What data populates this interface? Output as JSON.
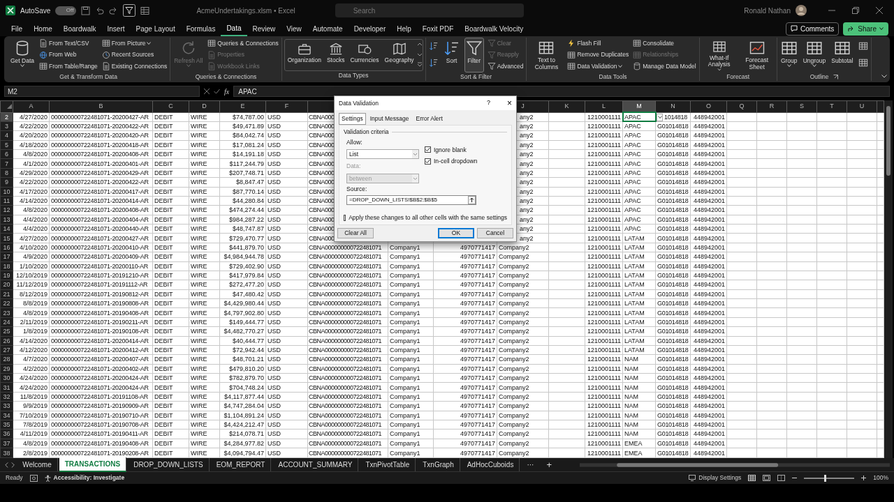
{
  "title_bar": {
    "autosave_label": "AutoSave",
    "autosave": {
      "on": false,
      "label": "Off"
    },
    "file_title": "AcmeUndertakings.xlsm • Excel",
    "search_placeholder": "Search",
    "user": "Ronald Nathan"
  },
  "menu_tabs": [
    {
      "label": "File",
      "selected": false
    },
    {
      "label": "Home",
      "selected": false
    },
    {
      "label": "Boardwalk",
      "selected": false
    },
    {
      "label": "Insert",
      "selected": false
    },
    {
      "label": "Page Layout",
      "selected": false
    },
    {
      "label": "Formulas",
      "selected": false
    },
    {
      "label": "Data",
      "selected": true
    },
    {
      "label": "Review",
      "selected": false
    },
    {
      "label": "View",
      "selected": false
    },
    {
      "label": "Automate",
      "selected": false
    },
    {
      "label": "Developer",
      "selected": false
    },
    {
      "label": "Help",
      "selected": false
    },
    {
      "label": "Foxit PDF",
      "selected": false
    },
    {
      "label": "Boardwalk Velocity",
      "selected": false
    }
  ],
  "comments_button": "Comments",
  "share_button": "Share",
  "ribbon": {
    "groups": [
      {
        "label": "Get & Transform Data",
        "kind": "buttons",
        "launcher": false,
        "items": [
          {
            "kind": "large",
            "label": "Get Data",
            "disabled": false,
            "dropdown": true,
            "pressed": false
          },
          {
            "kind": "small",
            "label": "From Text/CSV",
            "disabled": false,
            "dropdown": false,
            "pressed": false
          },
          {
            "kind": "small",
            "label": "From Web",
            "disabled": false,
            "dropdown": false,
            "pressed": false
          },
          {
            "kind": "small",
            "label": "From Table/Range",
            "disabled": false,
            "dropdown": false,
            "pressed": false
          },
          {
            "kind": "small",
            "label": "From Picture",
            "disabled": false,
            "dropdown": true,
            "pressed": false
          },
          {
            "kind": "small",
            "label": "Recent Sources",
            "disabled": false,
            "dropdown": false,
            "pressed": false
          },
          {
            "kind": "small",
            "label": "Existing Connections",
            "disabled": false,
            "dropdown": false,
            "pressed": false
          }
        ]
      },
      {
        "label": "Queries & Connections",
        "kind": "buttons",
        "launcher": false,
        "items": [
          {
            "kind": "large",
            "label": "Refresh All",
            "disabled": true,
            "dropdown": true,
            "pressed": false
          },
          {
            "kind": "small",
            "label": "Queries & Connections",
            "disabled": false,
            "dropdown": false,
            "pressed": false
          },
          {
            "kind": "small",
            "label": "Properties",
            "disabled": true,
            "dropdown": false,
            "pressed": false
          },
          {
            "kind": "small",
            "label": "Workbook Links",
            "disabled": true,
            "dropdown": false,
            "pressed": false
          }
        ]
      },
      {
        "label": "Data Types",
        "kind": "gallery",
        "launcher": false,
        "items": [
          {
            "kind": "large",
            "label": "Organization",
            "disabled": false,
            "dropdown": false,
            "pressed": false
          },
          {
            "kind": "large",
            "label": "Stocks",
            "disabled": false,
            "dropdown": false,
            "pressed": false
          },
          {
            "kind": "large",
            "label": "Currencies",
            "disabled": false,
            "dropdown": false,
            "pressed": false
          },
          {
            "kind": "large",
            "label": "Geography",
            "disabled": false,
            "dropdown": false,
            "pressed": false
          }
        ]
      },
      {
        "label": "Sort & Filter",
        "kind": "buttons",
        "launcher": false,
        "items": [
          {
            "kind": "icon",
            "disabled": false,
            "dropdown": false,
            "pressed": false
          },
          {
            "kind": "icon",
            "disabled": false,
            "dropdown": false,
            "pressed": false
          },
          {
            "kind": "large",
            "label": "Sort",
            "disabled": false,
            "dropdown": false,
            "pressed": false
          },
          {
            "kind": "large",
            "label": "Filter",
            "disabled": false,
            "dropdown": false,
            "pressed": true
          },
          {
            "kind": "small",
            "label": "Clear",
            "disabled": true,
            "dropdown": false,
            "pressed": false
          },
          {
            "kind": "small",
            "label": "Reapply",
            "disabled": true,
            "dropdown": false,
            "pressed": false
          },
          {
            "kind": "small",
            "label": "Advanced",
            "disabled": false,
            "dropdown": false,
            "pressed": false
          }
        ]
      },
      {
        "label": "Data Tools",
        "kind": "buttons",
        "launcher": false,
        "items": [
          {
            "kind": "large",
            "label": "Text to Columns",
            "disabled": false,
            "dropdown": false,
            "pressed": false
          },
          {
            "kind": "small",
            "label": "Flash Fill",
            "disabled": false,
            "dropdown": false,
            "pressed": false
          },
          {
            "kind": "small",
            "label": "Remove Duplicates",
            "disabled": false,
            "dropdown": false,
            "pressed": false
          },
          {
            "kind": "small",
            "label": "Data Validation",
            "disabled": false,
            "dropdown": true,
            "pressed": false
          },
          {
            "kind": "small",
            "label": "Consolidate",
            "disabled": false,
            "dropdown": false,
            "pressed": false
          },
          {
            "kind": "small",
            "label": "Relationships",
            "disabled": true,
            "dropdown": false,
            "pressed": false
          },
          {
            "kind": "small",
            "label": "Manage Data Model",
            "disabled": false,
            "dropdown": false,
            "pressed": false
          }
        ]
      },
      {
        "label": "Forecast",
        "kind": "buttons",
        "launcher": false,
        "items": [
          {
            "kind": "large",
            "label": "What-If Analysis",
            "disabled": false,
            "dropdown": true,
            "pressed": false
          },
          {
            "kind": "large",
            "label": "Forecast Sheet",
            "disabled": false,
            "dropdown": false,
            "pressed": false
          }
        ]
      },
      {
        "label": "Outline",
        "kind": "buttons",
        "launcher": true,
        "items": [
          {
            "kind": "large",
            "label": "Group",
            "disabled": false,
            "dropdown": true,
            "pressed": false
          },
          {
            "kind": "large",
            "label": "Ungroup",
            "disabled": false,
            "dropdown": true,
            "pressed": false
          },
          {
            "kind": "large",
            "label": "Subtotal",
            "disabled": false,
            "dropdown": false,
            "pressed": false
          },
          {
            "kind": "icon",
            "disabled": false,
            "dropdown": false,
            "pressed": false
          },
          {
            "kind": "icon",
            "disabled": false,
            "dropdown": false,
            "pressed": false
          }
        ]
      }
    ]
  },
  "formula_bar": {
    "name_box": "M2",
    "fx": "fx",
    "formula": "APAC"
  },
  "grid": {
    "active_dropdown": true,
    "columns": [
      {
        "label": "A",
        "selected": false
      },
      {
        "label": "B",
        "selected": false
      },
      {
        "label": "C",
        "selected": false
      },
      {
        "label": "D",
        "selected": false
      },
      {
        "label": "E",
        "selected": false
      },
      {
        "label": "F",
        "selected": false
      },
      null,
      null,
      null,
      {
        "label": "J",
        "selected": false
      },
      {
        "label": "K",
        "selected": false
      },
      {
        "label": "L",
        "selected": false
      },
      {
        "label": "M",
        "selected": true
      },
      {
        "label": "N",
        "selected": false
      },
      {
        "label": "O",
        "selected": false
      },
      {
        "label": "Q",
        "selected": false
      },
      {
        "label": "R",
        "selected": false
      },
      {
        "label": "S",
        "selected": false
      },
      {
        "label": "T",
        "selected": false
      },
      {
        "label": "U",
        "selected": false
      }
    ],
    "rows": [
      {
        "row": "2",
        "selected": true,
        "covered": true,
        "cells": [
          "4/27/2020",
          "000000000722481071-20200427-AR",
          "DEBIT",
          "WIRE",
          "$74,787.00",
          "USD",
          "CBNA000",
          null,
          null,
          "any2",
          null,
          "1210001111",
          "APAC",
          "1014818",
          "448942001"
        ]
      },
      {
        "row": "3",
        "selected": false,
        "covered": true,
        "cells": [
          "4/22/2020",
          "000000000722481071-20200422-AR",
          "DEBIT",
          "WIRE",
          "$49,471.89",
          "USD",
          "CBNA000",
          null,
          null,
          "any2",
          null,
          "1210001111",
          "APAC",
          "G01014818",
          "448942001"
        ]
      },
      {
        "row": "4",
        "selected": false,
        "covered": true,
        "cells": [
          "4/20/2020",
          "000000000722481071-20200420-AR",
          "DEBIT",
          "WIRE",
          "$84,042.74",
          "USD",
          "CBNA000",
          null,
          null,
          "any2",
          null,
          "1210001111",
          "APAC",
          "G01014818",
          "448942001"
        ]
      },
      {
        "row": "5",
        "selected": false,
        "covered": true,
        "cells": [
          "4/18/2020",
          "000000000722481071-20200418-AR",
          "DEBIT",
          "WIRE",
          "$17,081.24",
          "USD",
          "CBNA000",
          null,
          null,
          "any2",
          null,
          "1210001111",
          "APAC",
          "G01014818",
          "448942001"
        ]
      },
      {
        "row": "6",
        "selected": false,
        "covered": true,
        "cells": [
          "4/8/2020",
          "000000000722481071-20200408-AR",
          "DEBIT",
          "WIRE",
          "$14,191.18",
          "USD",
          "CBNA000",
          null,
          null,
          "any2",
          null,
          "1210001111",
          "APAC",
          "G01014818",
          "448942001"
        ]
      },
      {
        "row": "7",
        "selected": false,
        "covered": true,
        "cells": [
          "4/1/2020",
          "000000000722481071-20200401-AR",
          "DEBIT",
          "WIRE",
          "$117,244.79",
          "USD",
          "CBNA000",
          null,
          null,
          "any2",
          null,
          "1210001111",
          "APAC",
          "G01014818",
          "448942001"
        ]
      },
      {
        "row": "8",
        "selected": false,
        "covered": true,
        "cells": [
          "4/29/2020",
          "000000000722481071-20200429-AR",
          "DEBIT",
          "WIRE",
          "$207,748.71",
          "USD",
          "CBNA000",
          null,
          null,
          "any2",
          null,
          "1210001111",
          "APAC",
          "G01014818",
          "448942001"
        ]
      },
      {
        "row": "9",
        "selected": false,
        "covered": true,
        "cells": [
          "4/22/2020",
          "000000000722481071-20200422-AR",
          "DEBIT",
          "WIRE",
          "$8,847.47",
          "USD",
          "CBNA000",
          null,
          null,
          "any2",
          null,
          "1210001111",
          "APAC",
          "G01014818",
          "448942001"
        ]
      },
      {
        "row": "10",
        "selected": false,
        "covered": true,
        "cells": [
          "4/17/2020",
          "000000000722481071-20200417-AR",
          "DEBIT",
          "WIRE",
          "$87,770.14",
          "USD",
          "CBNA000",
          null,
          null,
          "any2",
          null,
          "1210001111",
          "APAC",
          "G01014818",
          "448942001"
        ]
      },
      {
        "row": "11",
        "selected": false,
        "covered": true,
        "cells": [
          "4/14/2020",
          "000000000722481071-20200414-AR",
          "DEBIT",
          "WIRE",
          "$44,280.84",
          "USD",
          "CBNA000",
          null,
          null,
          "any2",
          null,
          "1210001111",
          "APAC",
          "G01014818",
          "448942001"
        ]
      },
      {
        "row": "12",
        "selected": false,
        "covered": true,
        "cells": [
          "4/8/2020",
          "000000000722481071-20200408-AR",
          "DEBIT",
          "WIRE",
          "$474,274.44",
          "USD",
          "CBNA000",
          null,
          null,
          "any2",
          null,
          "1210001111",
          "APAC",
          "G01014818",
          "448942001"
        ]
      },
      {
        "row": "13",
        "selected": false,
        "covered": true,
        "cells": [
          "4/4/2020",
          "000000000722481071-20200404-AR",
          "DEBIT",
          "WIRE",
          "$984,287.22",
          "USD",
          "CBNA000",
          null,
          null,
          "any2",
          null,
          "1210001111",
          "APAC",
          "G01014818",
          "448942001"
        ]
      },
      {
        "row": "14",
        "selected": false,
        "covered": true,
        "cells": [
          "4/4/2020",
          "000000000722481071-20200440-AR",
          "DEBIT",
          "WIRE",
          "$48,747.87",
          "USD",
          "CBNA000",
          null,
          null,
          "any2",
          null,
          "1210001111",
          "APAC",
          "G01014818",
          "448942001"
        ]
      },
      {
        "row": "15",
        "selected": false,
        "covered": true,
        "cells": [
          "4/27/2020",
          "000000000722481071-20200427-AR",
          "DEBIT",
          "WIRE",
          "$729,470.77",
          "USD",
          "CBNA000",
          null,
          null,
          "any2",
          null,
          "1210001111",
          "LATAM",
          "G01014818",
          "448942001"
        ]
      },
      {
        "row": "16",
        "selected": false,
        "covered": false,
        "cells": [
          "4/10/2020",
          "000000000722481071-20200410-AR",
          "DEBIT",
          "WIRE",
          "$441,879.70",
          "USD",
          "CBNA000000000722481071",
          "Company1",
          "4970771417",
          "Company2",
          null,
          "1210001111",
          "LATAM",
          "G01014818",
          "448942001"
        ]
      },
      {
        "row": "17",
        "selected": false,
        "covered": false,
        "cells": [
          "4/9/2020",
          "000000000722481071-20200409-AR",
          "DEBIT",
          "WIRE",
          "$4,984,944.78",
          "USD",
          "CBNA000000000722481071",
          "Company1",
          "4970771417",
          "Company2",
          null,
          "1210001111",
          "LATAM",
          "G01014818",
          "448942001"
        ]
      },
      {
        "row": "18",
        "selected": false,
        "covered": false,
        "cells": [
          "1/10/2020",
          "000000000722481071-20200110-AR",
          "DEBIT",
          "WIRE",
          "$729,402.90",
          "USD",
          "CBNA000000000722481071",
          "Company1",
          "4970771417",
          "Company2",
          null,
          "1210001111",
          "LATAM",
          "G01014818",
          "448942001"
        ]
      },
      {
        "row": "19",
        "selected": false,
        "covered": false,
        "cells": [
          "12/10/2019",
          "000000000722481071-20191210-AR",
          "DEBIT",
          "WIRE",
          "$417,979.84",
          "USD",
          "CBNA000000000722481071",
          "Company1",
          "4970771417",
          "Company2",
          null,
          "1210001111",
          "LATAM",
          "G01014818",
          "448942001"
        ]
      },
      {
        "row": "20",
        "selected": false,
        "covered": false,
        "cells": [
          "11/12/2019",
          "000000000722481071-20191112-AR",
          "DEBIT",
          "WIRE",
          "$272,477.20",
          "USD",
          "CBNA000000000722481071",
          "Company1",
          "4970771417",
          "Company2",
          null,
          "1210001111",
          "LATAM",
          "G01014818",
          "448942001"
        ]
      },
      {
        "row": "21",
        "selected": false,
        "covered": false,
        "cells": [
          "8/12/2019",
          "000000000722481071-20190812-AR",
          "DEBIT",
          "WIRE",
          "$47,480.42",
          "USD",
          "CBNA000000000722481071",
          "Company1",
          "4970771417",
          "Company2",
          null,
          "1210001111",
          "LATAM",
          "G01014818",
          "448942001"
        ]
      },
      {
        "row": "22",
        "selected": false,
        "covered": false,
        "cells": [
          "8/8/2019",
          "000000000722481071-20190808-AR",
          "DEBIT",
          "WIRE",
          "$4,429,980.44",
          "USD",
          "CBNA000000000722481071",
          "Company1",
          "4970771417",
          "Company2",
          null,
          "1210001111",
          "LATAM",
          "G01014818",
          "448942001"
        ]
      },
      {
        "row": "23",
        "selected": false,
        "covered": false,
        "cells": [
          "4/8/2019",
          "000000000722481071-20190408-AR",
          "DEBIT",
          "WIRE",
          "$4,797,902.80",
          "USD",
          "CBNA000000000722481071",
          "Company1",
          "4970771417",
          "Company2",
          null,
          "1210001111",
          "LATAM",
          "G01014818",
          "448942001"
        ]
      },
      {
        "row": "24",
        "selected": false,
        "covered": false,
        "cells": [
          "2/11/2019",
          "000000000722481071-20190211-AR",
          "DEBIT",
          "WIRE",
          "$149,444.77",
          "USD",
          "CBNA000000000722481071",
          "Company1",
          "4970771417",
          "Company2",
          null,
          "1210001111",
          "LATAM",
          "G01014818",
          "448942001"
        ]
      },
      {
        "row": "25",
        "selected": false,
        "covered": false,
        "cells": [
          "1/8/2019",
          "000000000722481071-20190108-AR",
          "DEBIT",
          "WIRE",
          "$4,482,770.27",
          "USD",
          "CBNA000000000722481071",
          "Company1",
          "4970771417",
          "Company2",
          null,
          "1210001111",
          "LATAM",
          "G01014818",
          "448942001"
        ]
      },
      {
        "row": "26",
        "selected": false,
        "covered": false,
        "cells": [
          "4/14/2020",
          "000000000722481071-20200414-AR",
          "DEBIT",
          "WIRE",
          "$40,444.77",
          "USD",
          "CBNA000000000722481071",
          "Company1",
          "4970771417",
          "Company2",
          null,
          "1210001111",
          "LATAM",
          "G01014818",
          "448942001"
        ]
      },
      {
        "row": "27",
        "selected": false,
        "covered": false,
        "cells": [
          "4/12/2020",
          "000000000722481071-20200412-AR",
          "DEBIT",
          "WIRE",
          "$72,942.44",
          "USD",
          "CBNA000000000722481071",
          "Company1",
          "4970771417",
          "Company2",
          null,
          "1210001111",
          "LATAM",
          "G01014818",
          "448942001"
        ]
      },
      {
        "row": "28",
        "selected": false,
        "covered": false,
        "cells": [
          "4/7/2020",
          "000000000722481071-20200407-AR",
          "DEBIT",
          "WIRE",
          "$48,701.21",
          "USD",
          "CBNA000000000722481071",
          "Company1",
          "4970771417",
          "Company2",
          null,
          "1210001111",
          "NAM",
          "G01014818",
          "448942001"
        ]
      },
      {
        "row": "29",
        "selected": false,
        "covered": false,
        "cells": [
          "4/2/2020",
          "000000000722481071-20200402-AR",
          "DEBIT",
          "WIRE",
          "$479,810.20",
          "USD",
          "CBNA000000000722481071",
          "Company1",
          "4970771417",
          "Company2",
          null,
          "1210001111",
          "NAM",
          "G01014818",
          "448942001"
        ]
      },
      {
        "row": "30",
        "selected": false,
        "covered": false,
        "cells": [
          "4/24/2020",
          "000000000722481071-20200424-AR",
          "DEBIT",
          "WIRE",
          "$782,879.70",
          "USD",
          "CBNA000000000722481071",
          "Company1",
          "4970771417",
          "Company2",
          null,
          "1210001111",
          "NAM",
          "G01014818",
          "448942001"
        ]
      },
      {
        "row": "31",
        "selected": false,
        "covered": false,
        "cells": [
          "4/24/2020",
          "000000000722481071-20200424-AR",
          "DEBIT",
          "WIRE",
          "$704,748.24",
          "USD",
          "CBNA000000000722481071",
          "Company1",
          "4970771417",
          "Company2",
          null,
          "1210001111",
          "NAM",
          "G01014818",
          "448942001"
        ]
      },
      {
        "row": "32",
        "selected": false,
        "covered": false,
        "cells": [
          "11/8/2019",
          "000000000722481071-20191108-AR",
          "DEBIT",
          "WIRE",
          "$4,117,877.44",
          "USD",
          "CBNA000000000722481071",
          "Company1",
          "4970771417",
          "Company2",
          null,
          "1210001111",
          "NAM",
          "G01014818",
          "448942001"
        ]
      },
      {
        "row": "33",
        "selected": false,
        "covered": false,
        "cells": [
          "9/9/2019",
          "000000000722481071-20190909-AR",
          "DEBIT",
          "WIRE",
          "$4,747,284.04",
          "USD",
          "CBNA000000000722481071",
          "Company1",
          "4970771417",
          "Company2",
          null,
          "1210001111",
          "NAM",
          "G01014818",
          "448942001"
        ]
      },
      {
        "row": "34",
        "selected": false,
        "covered": false,
        "cells": [
          "7/10/2019",
          "000000000722481071-20190710-AR",
          "DEBIT",
          "WIRE",
          "$1,104,891.24",
          "USD",
          "CBNA000000000722481071",
          "Company1",
          "4970771417",
          "Company2",
          null,
          "1210001111",
          "NAM",
          "G01014818",
          "448942001"
        ]
      },
      {
        "row": "35",
        "selected": false,
        "covered": false,
        "cells": [
          "7/8/2019",
          "000000000722481071-20190708-AR",
          "DEBIT",
          "WIRE",
          "$4,424,212.47",
          "USD",
          "CBNA000000000722481071",
          "Company1",
          "4970771417",
          "Company2",
          null,
          "1210001111",
          "NAM",
          "G01014818",
          "448942001"
        ]
      },
      {
        "row": "36",
        "selected": false,
        "covered": false,
        "cells": [
          "4/11/2019",
          "000000000722481071-20190411-AR",
          "DEBIT",
          "WIRE",
          "$214,078.71",
          "USD",
          "CBNA000000000722481071",
          "Company1",
          "4970771417",
          "Company2",
          null,
          "1210001111",
          "NAM",
          "G01014818",
          "448942001"
        ]
      },
      {
        "row": "37",
        "selected": false,
        "covered": false,
        "cells": [
          "4/8/2019",
          "000000000722481071-20190408-AR",
          "DEBIT",
          "WIRE",
          "$4,284,977.82",
          "USD",
          "CBNA000000000722481071",
          "Company1",
          "4970771417",
          "Company2",
          null,
          "1210001111",
          "EMEA",
          "G01014818",
          "448942001"
        ]
      },
      {
        "row": "38",
        "selected": false,
        "covered": false,
        "cells": [
          "2/8/2019",
          "000000000722481071-20190208-AR",
          "DEBIT",
          "WIRE",
          "$4,094,794.47",
          "USD",
          "CBNA000000000722481071",
          "Company1",
          "4970771417",
          "Company2",
          null,
          "1210001111",
          "EMEA",
          "G01014818",
          "448942001"
        ]
      }
    ]
  },
  "dialog": {
    "title": "Data Validation",
    "help": "?",
    "close": "×",
    "tabs": [
      {
        "label": "Settings",
        "selected": true
      },
      {
        "label": "Input Message",
        "selected": false
      },
      {
        "label": "Error Alert",
        "selected": false
      }
    ],
    "section": "Validation criteria",
    "allow_label": "Allow:",
    "allow_value": "List",
    "checks": [
      {
        "label": "Ignore blank",
        "checked": true
      },
      {
        "label": "In-cell dropdown",
        "checked": true
      }
    ],
    "data_label": "Data:",
    "data_value": "between",
    "data_disabled": true,
    "source_label": "Source:",
    "source_value": "=DROP_DOWN_LISTS!$B$2:$B$5",
    "apply": {
      "label": "Apply these changes to all other cells with the same settings",
      "checked": false
    },
    "buttons": [
      {
        "label": "Clear All",
        "default": false
      },
      {
        "label": "OK",
        "default": true
      },
      {
        "label": "Cancel",
        "default": false
      }
    ]
  },
  "sheet_tabs": [
    {
      "label": "Welcome",
      "selected": false
    },
    {
      "label": "TRANSACTIONS",
      "selected": true
    },
    {
      "label": "DROP_DOWN_LISTS",
      "selected": false
    },
    {
      "label": "EOM_REPORT",
      "selected": false
    },
    {
      "label": "ACCOUNT_SUMMARY",
      "selected": false
    },
    {
      "label": "TxnPivotTable",
      "selected": false
    },
    {
      "label": "TxnGraph",
      "selected": false
    },
    {
      "label": "AdHocCuboids",
      "selected": false
    }
  ],
  "more_sheets": "···",
  "add_sheet": "+",
  "status_bar": {
    "state": "Ready",
    "accessibility": "Accessibility: Investigate",
    "display_settings": "Display Settings",
    "zoom": {
      "level": 0.4
    },
    "zoom_text": "100%"
  }
}
